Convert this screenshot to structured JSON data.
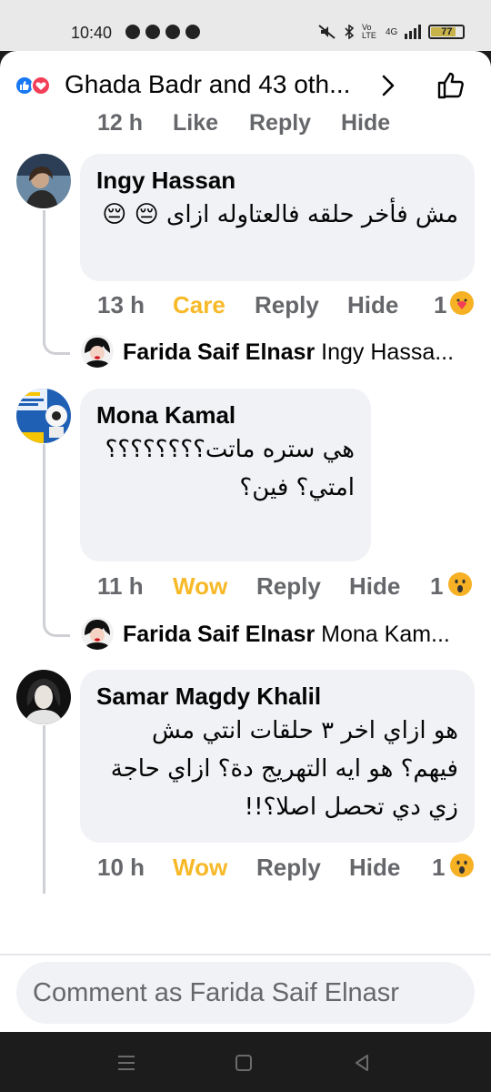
{
  "status_bar": {
    "time": "10:40",
    "volte": "Vo LTE",
    "network": "4G",
    "battery": "77",
    "battery_level": 0.77,
    "battery_color": "#c8b34a"
  },
  "header": {
    "title": "Ghada Badr and 43 oth...",
    "like_color": "#1877f2",
    "love_color": "#f33e58"
  },
  "partial_row": {
    "time": "12 h",
    "reaction": "Like",
    "reply": "Reply",
    "hide": "Hide"
  },
  "comments": [
    {
      "author": "Ingy Hassan",
      "text": "مش فأخر حلقه فالعتاوله ازاى 😔 😔",
      "time": "13 h",
      "reaction_label": "Care",
      "reply_label": "Reply",
      "hide_label": "Hide",
      "reaction_count": "1",
      "reply_preview": {
        "author": "Farida Saif Elnasr",
        "text": "Ingy Hassa..."
      }
    },
    {
      "author": "Mona Kamal",
      "text": "هي ستره ماتت؟؟؟؟؟؟؟؟ امتي؟ فين؟",
      "time": "11 h",
      "reaction_label": "Wow",
      "reply_label": "Reply",
      "hide_label": "Hide",
      "reaction_count": "1",
      "reply_preview": {
        "author": "Farida Saif Elnasr",
        "text": "Mona Kam..."
      }
    },
    {
      "author": "Samar Magdy Khalil",
      "text": "هو ازاي اخر ٣ حلقات انتي مش فيهم؟ هو ايه التهريج دة؟ ازاي حاجة زي دي تحصل اصلا؟!!",
      "time": "10 h",
      "reaction_label": "Wow",
      "reply_label": "Reply",
      "hide_label": "Hide",
      "reaction_count": "1"
    }
  ],
  "composer": {
    "placeholder": "Comment as Farida Saif Elnasr"
  },
  "colors": {
    "accent_reaction": "#f7b928",
    "bubble_bg": "#f0f2f5",
    "secondary_text": "#65676b"
  }
}
